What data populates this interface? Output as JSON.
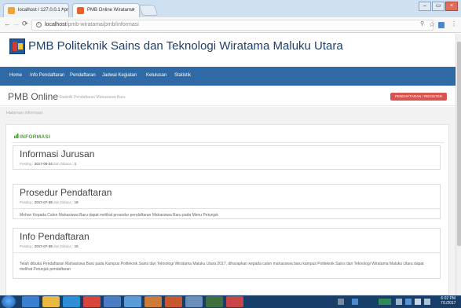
{
  "browser": {
    "tabs": [
      {
        "label": "localhost / 127.0.0.1 / pr",
        "active": false
      },
      {
        "label": "PMB Online Wiratama",
        "active": false
      }
    ],
    "tab_close": "×",
    "window_controls": {
      "minimize": "–",
      "restore": "▭",
      "close": "×"
    },
    "url_host": "localhost",
    "url_path": "/pmb-wiratama/pmb/informasi"
  },
  "header": {
    "site_title": "PMB Politeknik Sains dan Teknologi Wiratama Maluku Utara"
  },
  "nav": {
    "items": [
      "Home",
      "Info Pendaftaran",
      "Pendaftaran",
      "Jadwal Kegiatan",
      "Kelulusan",
      "Statistik"
    ]
  },
  "pmb": {
    "title": "PMB Online",
    "subtitle": "Statistik Pendaftaran Mahasiswa Baru",
    "register_button": "PENDAFTARAN / REGISTER"
  },
  "breadcrumb": "Halaman informasi",
  "panel": {
    "title": "INFORMASI",
    "posts": [
      {
        "title": "Informasi Jurusan",
        "meta_prefix": "Posting : ",
        "date": "2017-05-24",
        "meta_mid": " dan Dibaca : ",
        "views": "1",
        "body": ""
      },
      {
        "title": "Prosedur Pendaftaran",
        "meta_prefix": "Posting : ",
        "date": "2017-07-08",
        "meta_mid": " dan Dibaca : ",
        "views": "19",
        "body": "Mohon Kepada Calon Mahasiswa Baru dapat melihat prosedur pendaftaran Mahasiswa Baru pada Menu Petunjuk"
      },
      {
        "title": "Info Pendaftaran",
        "meta_prefix": "Posting : ",
        "date": "2017-07-08",
        "meta_mid": " dan Dibaca : ",
        "views": "15",
        "body": "Telah dibuka Pendaftaran Mahasiswa Baru pada Kampus Politeknik Sains dan Teknologi Wiratama Maluku Utara 2017, diharapkan kepada calon mahasiswa baru kampus Politeknik Sains dan Teknologi Wiratama Maluku Utara dapat melihat Petunjuk pendaftaran"
      }
    ]
  },
  "taskbar": {
    "clock_time": "6:02 PM",
    "clock_date": "7/1/2017"
  },
  "colors": {
    "nav_blue": "#2f6aa7",
    "title_blue": "#1f3f6b",
    "register_red": "#d9534f",
    "panel_green": "#4e9a3a",
    "taskbar": "#173e68"
  }
}
